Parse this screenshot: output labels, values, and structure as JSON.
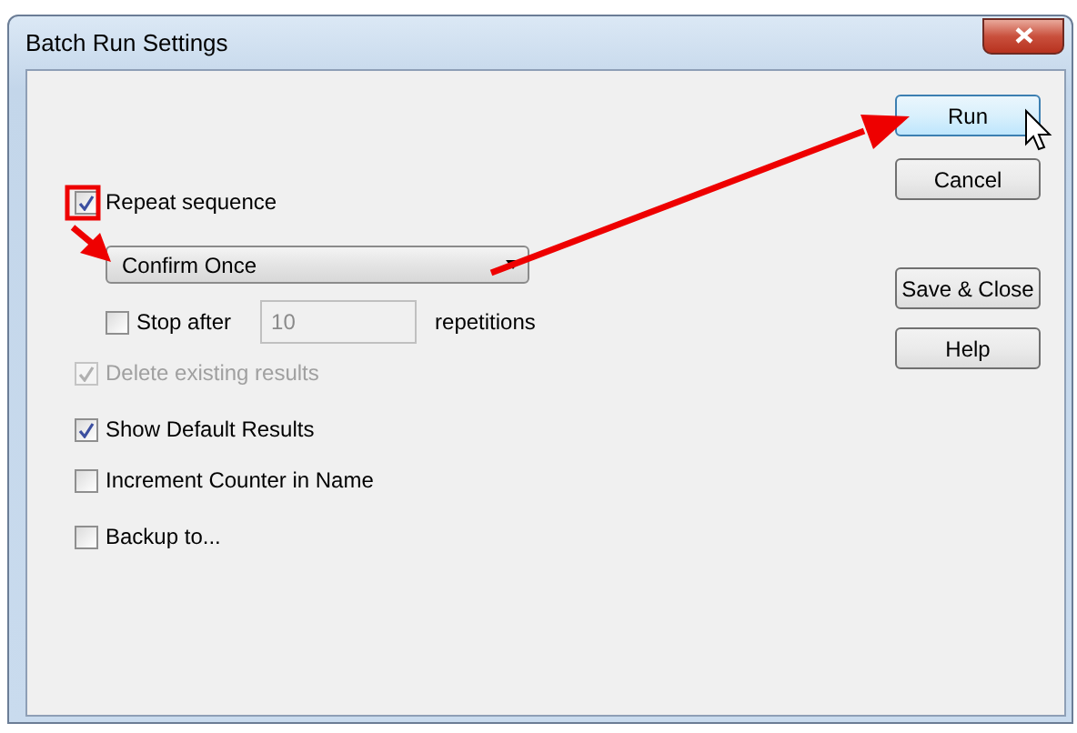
{
  "window": {
    "title": "Batch Run Settings"
  },
  "repeat": {
    "label": "Repeat sequence",
    "checked": true
  },
  "mode_dropdown": {
    "value": "Confirm Once"
  },
  "stop_after": {
    "label": "Stop after",
    "checked": false,
    "value": "10",
    "unit": "repetitions"
  },
  "options": [
    {
      "label": "Delete existing results",
      "checked": true,
      "disabled": true
    },
    {
      "label": "Show Default Results",
      "checked": true,
      "disabled": false
    },
    {
      "label": "Increment Counter in Name",
      "checked": false,
      "disabled": false
    },
    {
      "label": "Backup to...",
      "checked": false,
      "disabled": false
    }
  ],
  "buttons": [
    {
      "label": "Run",
      "selected": true
    },
    {
      "label": "Cancel",
      "selected": false
    },
    {
      "label": "Save & Close",
      "selected": false
    },
    {
      "label": "Help",
      "selected": false
    }
  ]
}
